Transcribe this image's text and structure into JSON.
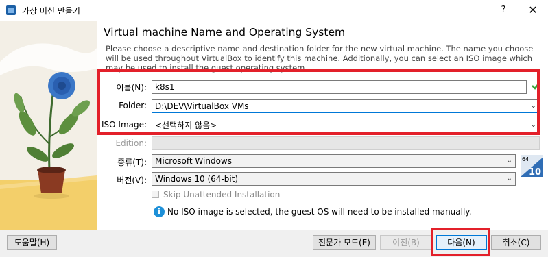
{
  "window": {
    "title": "가상 머신 만들기",
    "help": "?",
    "close": "✕"
  },
  "heading": "Virtual machine Name and Operating System",
  "description": "Please choose a descriptive name and destination folder for the new virtual machine. The name you choose will be used throughout VirtualBox to identify this machine. Additionally, you can select an ISO image which may be used to install the guest operating system.",
  "form": {
    "name_label": "이름(N):",
    "name_value": "k8s1",
    "folder_label": "Folder:",
    "folder_value": "D:\\DEV\\VirtualBox VMs",
    "iso_label": "ISO Image:",
    "iso_value": "<선택하지 않음>",
    "edition_label": "Edition:",
    "edition_value": "",
    "type_label": "종류(T):",
    "type_value": "Microsoft Windows",
    "version_label": "버전(V):",
    "version_value": "Windows 10 (64-bit)",
    "skip_label": "Skip Unattended Installation"
  },
  "os_badge": {
    "bits": "64",
    "version": "10"
  },
  "info": {
    "icon": "i",
    "text": "No ISO image is selected, the guest OS will need to be installed manually."
  },
  "buttons": {
    "help": "도움말(H)",
    "expert": "전문가 모드(E)",
    "back": "이전(B)",
    "next": "다음(N)",
    "cancel": "취소(C)"
  },
  "colors": {
    "highlight": "#e3202a",
    "accent": "#0078d7",
    "check": "#3aa33a"
  }
}
